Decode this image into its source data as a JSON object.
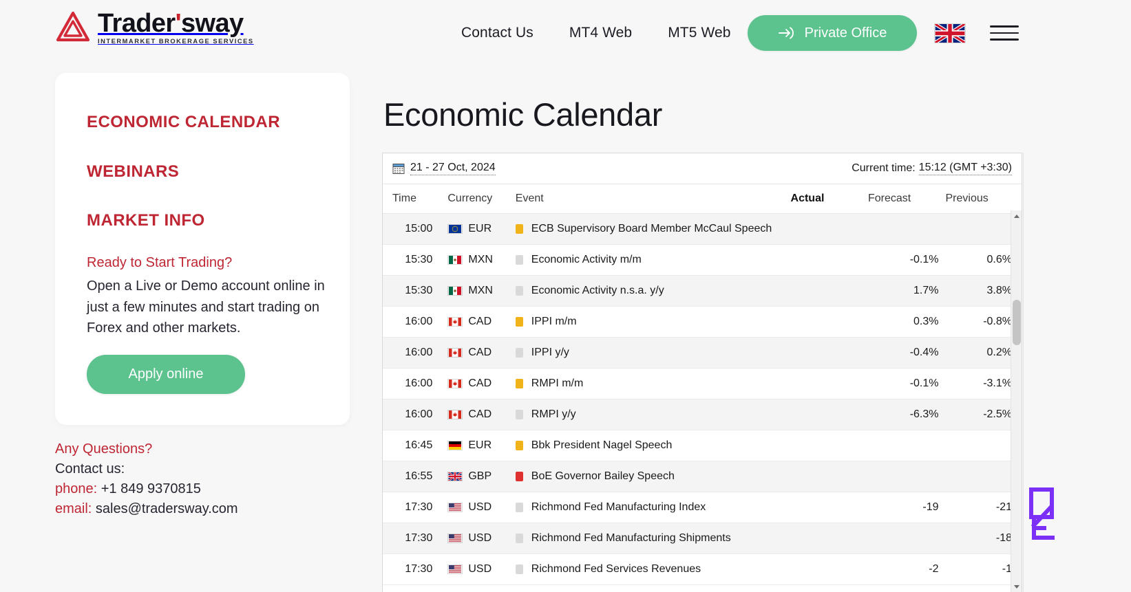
{
  "header": {
    "logo": {
      "name": "Tradersway",
      "word_a": "Trader",
      "apostrophe": "'",
      "word_b": "sway",
      "tagline": "INTERMARKET BROKERAGE SERVICES"
    },
    "nav": [
      {
        "label": "Contact Us"
      },
      {
        "label": "MT4 Web"
      },
      {
        "label": "MT5 Web"
      }
    ],
    "private_office_label": "Private Office",
    "language": "English (UK)",
    "menu_label": "Menu"
  },
  "sidebar": {
    "links": [
      {
        "label": "ECONOMIC CALENDAR"
      },
      {
        "label": "WEBINARS"
      },
      {
        "label": "MARKET INFO"
      }
    ],
    "promo": {
      "heading": "Ready to Start Trading?",
      "body": "Open a Live or Demo account online in just a few minutes and start trading on Forex and other markets.",
      "button": "Apply online"
    },
    "contact": {
      "title": "Any Questions?",
      "subtitle": "Contact us:",
      "phone_label": "phone:",
      "phone_value": "+1 849 9370815",
      "email_label": "email:",
      "email_value": "sales@tradersway.com"
    }
  },
  "main": {
    "title": "Economic Calendar",
    "calendar": {
      "date_range": "21 - 27 Oct, 2024",
      "current_time_label": "Current time:",
      "current_time_value": "15:12 (GMT +3:30)",
      "columns": {
        "time": "Time",
        "currency": "Currency",
        "event": "Event",
        "actual": "Actual",
        "forecast": "Forecast",
        "previous": "Previous"
      },
      "rows": [
        {
          "time": "15:00",
          "currency": "EUR",
          "flag": "eu",
          "importance": "med",
          "event": "ECB Supervisory Board Member McCaul Speech",
          "actual": "",
          "forecast": "",
          "previous": ""
        },
        {
          "time": "15:30",
          "currency": "MXN",
          "flag": "mx",
          "importance": "low",
          "event": "Economic Activity m/m",
          "actual": "",
          "forecast": "-0.1%",
          "previous": "0.6%"
        },
        {
          "time": "15:30",
          "currency": "MXN",
          "flag": "mx",
          "importance": "low",
          "event": "Economic Activity n.s.a. y/y",
          "actual": "",
          "forecast": "1.7%",
          "previous": "3.8%"
        },
        {
          "time": "16:00",
          "currency": "CAD",
          "flag": "ca",
          "importance": "med",
          "event": "IPPI m/m",
          "actual": "",
          "forecast": "0.3%",
          "previous": "-0.8%"
        },
        {
          "time": "16:00",
          "currency": "CAD",
          "flag": "ca",
          "importance": "low",
          "event": "IPPI y/y",
          "actual": "",
          "forecast": "-0.4%",
          "previous": "0.2%"
        },
        {
          "time": "16:00",
          "currency": "CAD",
          "flag": "ca",
          "importance": "med",
          "event": "RMPI m/m",
          "actual": "",
          "forecast": "-0.1%",
          "previous": "-3.1%"
        },
        {
          "time": "16:00",
          "currency": "CAD",
          "flag": "ca",
          "importance": "low",
          "event": "RMPI y/y",
          "actual": "",
          "forecast": "-6.3%",
          "previous": "-2.5%"
        },
        {
          "time": "16:45",
          "currency": "EUR",
          "flag": "de",
          "importance": "med",
          "event": "Bbk President Nagel Speech",
          "actual": "",
          "forecast": "",
          "previous": ""
        },
        {
          "time": "16:55",
          "currency": "GBP",
          "flag": "gb",
          "importance": "high",
          "event": "BoE Governor Bailey Speech",
          "actual": "",
          "forecast": "",
          "previous": ""
        },
        {
          "time": "17:30",
          "currency": "USD",
          "flag": "us",
          "importance": "low",
          "event": "Richmond Fed Manufacturing Index",
          "actual": "",
          "forecast": "-19",
          "previous": "-21"
        },
        {
          "time": "17:30",
          "currency": "USD",
          "flag": "us",
          "importance": "low",
          "event": "Richmond Fed Manufacturing Shipments",
          "actual": "",
          "forecast": "",
          "previous": "-18"
        },
        {
          "time": "17:30",
          "currency": "USD",
          "flag": "us",
          "importance": "low",
          "event": "Richmond Fed Services Revenues",
          "actual": "",
          "forecast": "-2",
          "previous": "-1"
        }
      ]
    }
  },
  "colors": {
    "brand_red": "#bf2633",
    "accent_green": "#5cc28e",
    "importance_low": "#d9d9d9",
    "importance_medium": "#f0b41a",
    "importance_high": "#e03131",
    "page_bg": "#f7f7f7",
    "watermark_purple": "#7b2ff7"
  }
}
